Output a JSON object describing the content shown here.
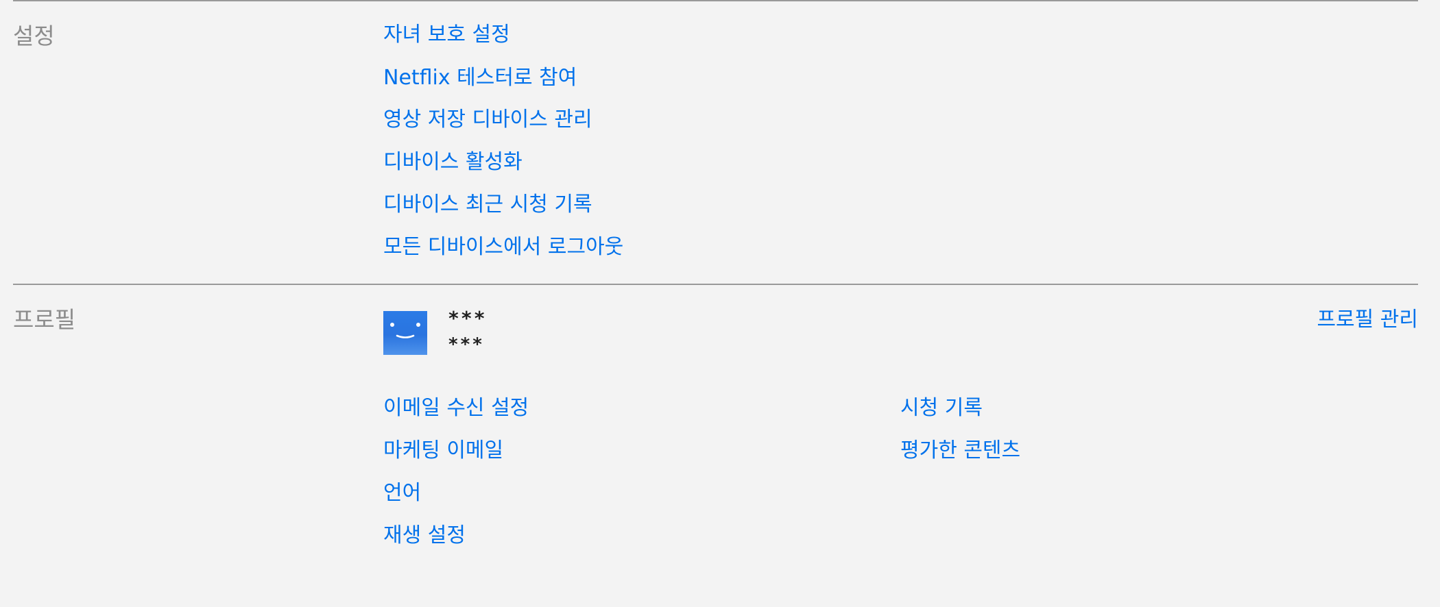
{
  "settings": {
    "label": "설정",
    "links": [
      "자녀 보호 설정",
      "Netflix 테스터로 참여",
      "영상 저장 디바이스 관리",
      "디바이스 활성화",
      "디바이스 최근 시청 기록",
      "모든 디바이스에서 로그아웃"
    ]
  },
  "profile": {
    "label": "프로필",
    "name_masked": "***",
    "detail_masked": "***",
    "manage_label": "프로필 관리",
    "left_links": [
      "이메일 수신 설정",
      "마케팅 이메일",
      "언어",
      "재생 설정"
    ],
    "right_links": [
      "시청 기록",
      "평가한 콘텐츠"
    ]
  },
  "colors": {
    "link": "#0071eb",
    "label": "#8c8c8c",
    "background": "#f3f3f3",
    "avatar": "#2b7be6"
  },
  "icons": {
    "avatar": "smiley-profile-icon"
  }
}
